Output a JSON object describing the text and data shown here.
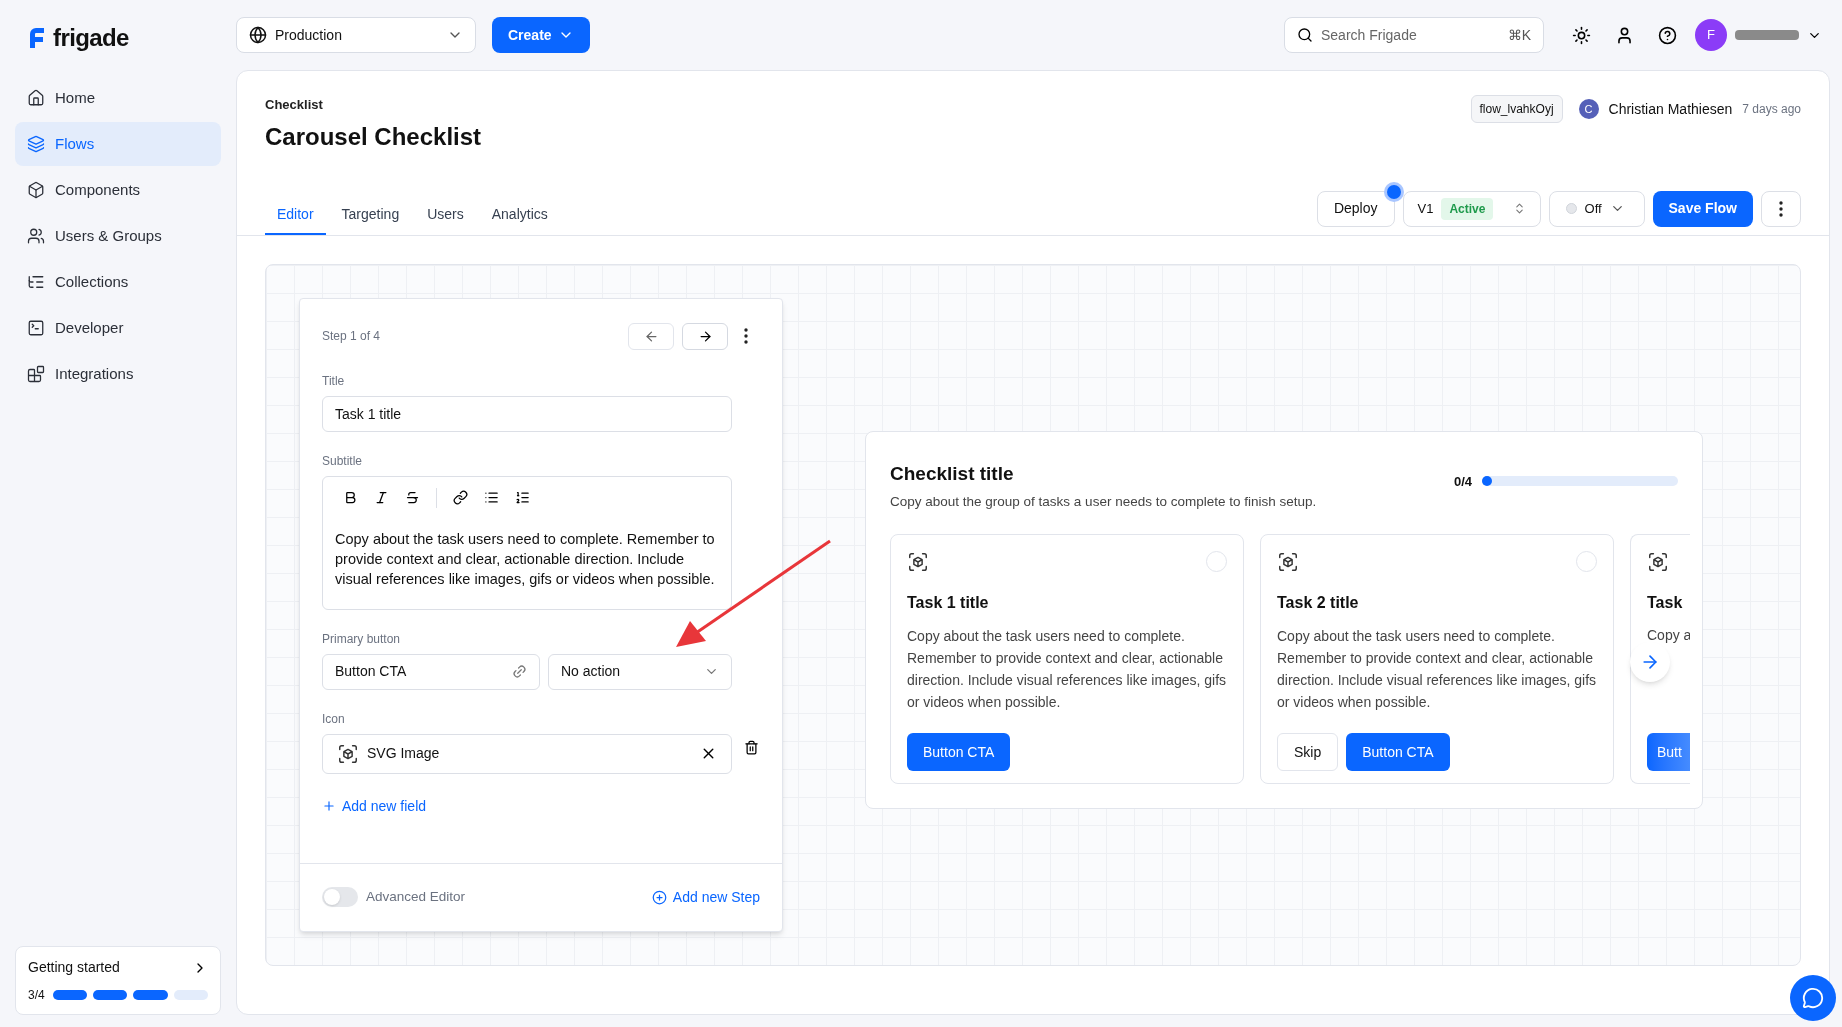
{
  "logo": {
    "text": "frigade"
  },
  "environment": {
    "value": "Production"
  },
  "create_button": "Create",
  "search": {
    "placeholder": "Search Frigade",
    "shortcut": "⌘K"
  },
  "account": {
    "avatar": "F"
  },
  "sidebar": {
    "items": [
      {
        "label": "Home",
        "selected": false
      },
      {
        "label": "Flows",
        "selected": true
      },
      {
        "label": "Components",
        "selected": false
      },
      {
        "label": "Users & Groups",
        "selected": false
      },
      {
        "label": "Collections",
        "selected": false
      },
      {
        "label": "Developer",
        "selected": false
      },
      {
        "label": "Integrations",
        "selected": false
      }
    ]
  },
  "getting_started": {
    "title": "Getting started",
    "count": "3/4",
    "segments": [
      {
        "filled": true
      },
      {
        "filled": true
      },
      {
        "filled": true
      },
      {
        "filled": false
      }
    ]
  },
  "header": {
    "type": "Checklist",
    "title": "Carousel Checklist",
    "flow_id": "flow_lvahkOyj",
    "author_initial": "C",
    "author": "Christian Mathiesen",
    "updated": "7 days ago"
  },
  "tabs": [
    {
      "label": "Editor",
      "selected": true
    },
    {
      "label": "Targeting",
      "selected": false
    },
    {
      "label": "Users",
      "selected": false
    },
    {
      "label": "Analytics",
      "selected": false
    }
  ],
  "toolbar": {
    "deploy": "Deploy",
    "deploy_pending": true,
    "version": "V1",
    "version_status": "Active",
    "state": {
      "label": "Off",
      "on": false
    },
    "save": "Save Flow"
  },
  "editor": {
    "step": "Step 1 of 4",
    "title_label": "Title",
    "title_value": "Task 1 title",
    "subtitle_label": "Subtitle",
    "subtitle_value": "Copy about the task users need to complete. Remember to provide context and clear, actionable direction. Include visual references like images, gifs or videos when possible.",
    "primary_label": "Primary button",
    "primary_value": "Button CTA",
    "action": "No action",
    "icon_label": "Icon",
    "icon_value": "SVG Image",
    "add_field": "Add new field",
    "advanced": {
      "label": "Advanced Editor",
      "on": false
    },
    "add_step": "Add new Step"
  },
  "preview": {
    "title": "Checklist title",
    "subtitle": "Copy about the group of tasks a user needs to complete to finish setup.",
    "progress": "0/4",
    "level": 0,
    "tasks": [
      {
        "title": "Task 1 title",
        "body": "Copy about the task users need to complete. Remember to provide context and clear, actionable direction. Include visual references like images, gifs or videos when possible.",
        "buttons": [
          {
            "label": "Button CTA",
            "kind": "primary"
          }
        ],
        "checked": false
      },
      {
        "title": "Task 2 title",
        "body": "Copy about the task users need to complete. Remember to provide context and clear, actionable direction. Include visual references like images, gifs or videos when possible.",
        "buttons": [
          {
            "label": "Skip",
            "kind": "secondary"
          },
          {
            "label": "Button CTA",
            "kind": "primary"
          }
        ],
        "checked": false
      }
    ],
    "peek": {
      "title": "Task",
      "body": "Copy a",
      "button": "Butt"
    }
  }
}
